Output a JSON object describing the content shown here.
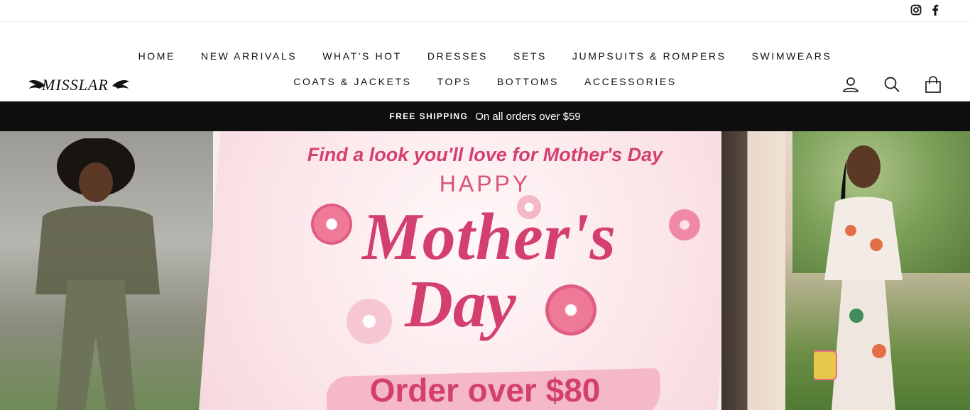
{
  "social": {
    "instagram": "instagram-icon",
    "facebook": "facebook-icon"
  },
  "brand": {
    "logo_text": "MISSLAR"
  },
  "nav": {
    "row1": [
      "HOME",
      "NEW ARRIVALS",
      "WHAT'S HOT",
      "DRESSES",
      "SETS",
      "JUMPSUITS & ROMPERS",
      "SWIMWEARS"
    ],
    "row2": [
      "COATS & JACKETS",
      "TOPS",
      "BOTTOMS",
      "ACCESSORIES"
    ]
  },
  "header_icons": {
    "login": "user-icon",
    "search": "search-icon",
    "cart": "bag-icon"
  },
  "announcement": {
    "strong": "FREE SHIPPING",
    "rest": "On all orders over $59"
  },
  "hero": {
    "headline": "Find a look you'll love for Mother's Day",
    "happy": "HAPPY",
    "script_line1": "Mother's",
    "script_line2": "Day",
    "offer": "Order over $80"
  },
  "colors": {
    "accent_pink": "#d3406f",
    "announcement_bg": "#0e0e0e"
  }
}
